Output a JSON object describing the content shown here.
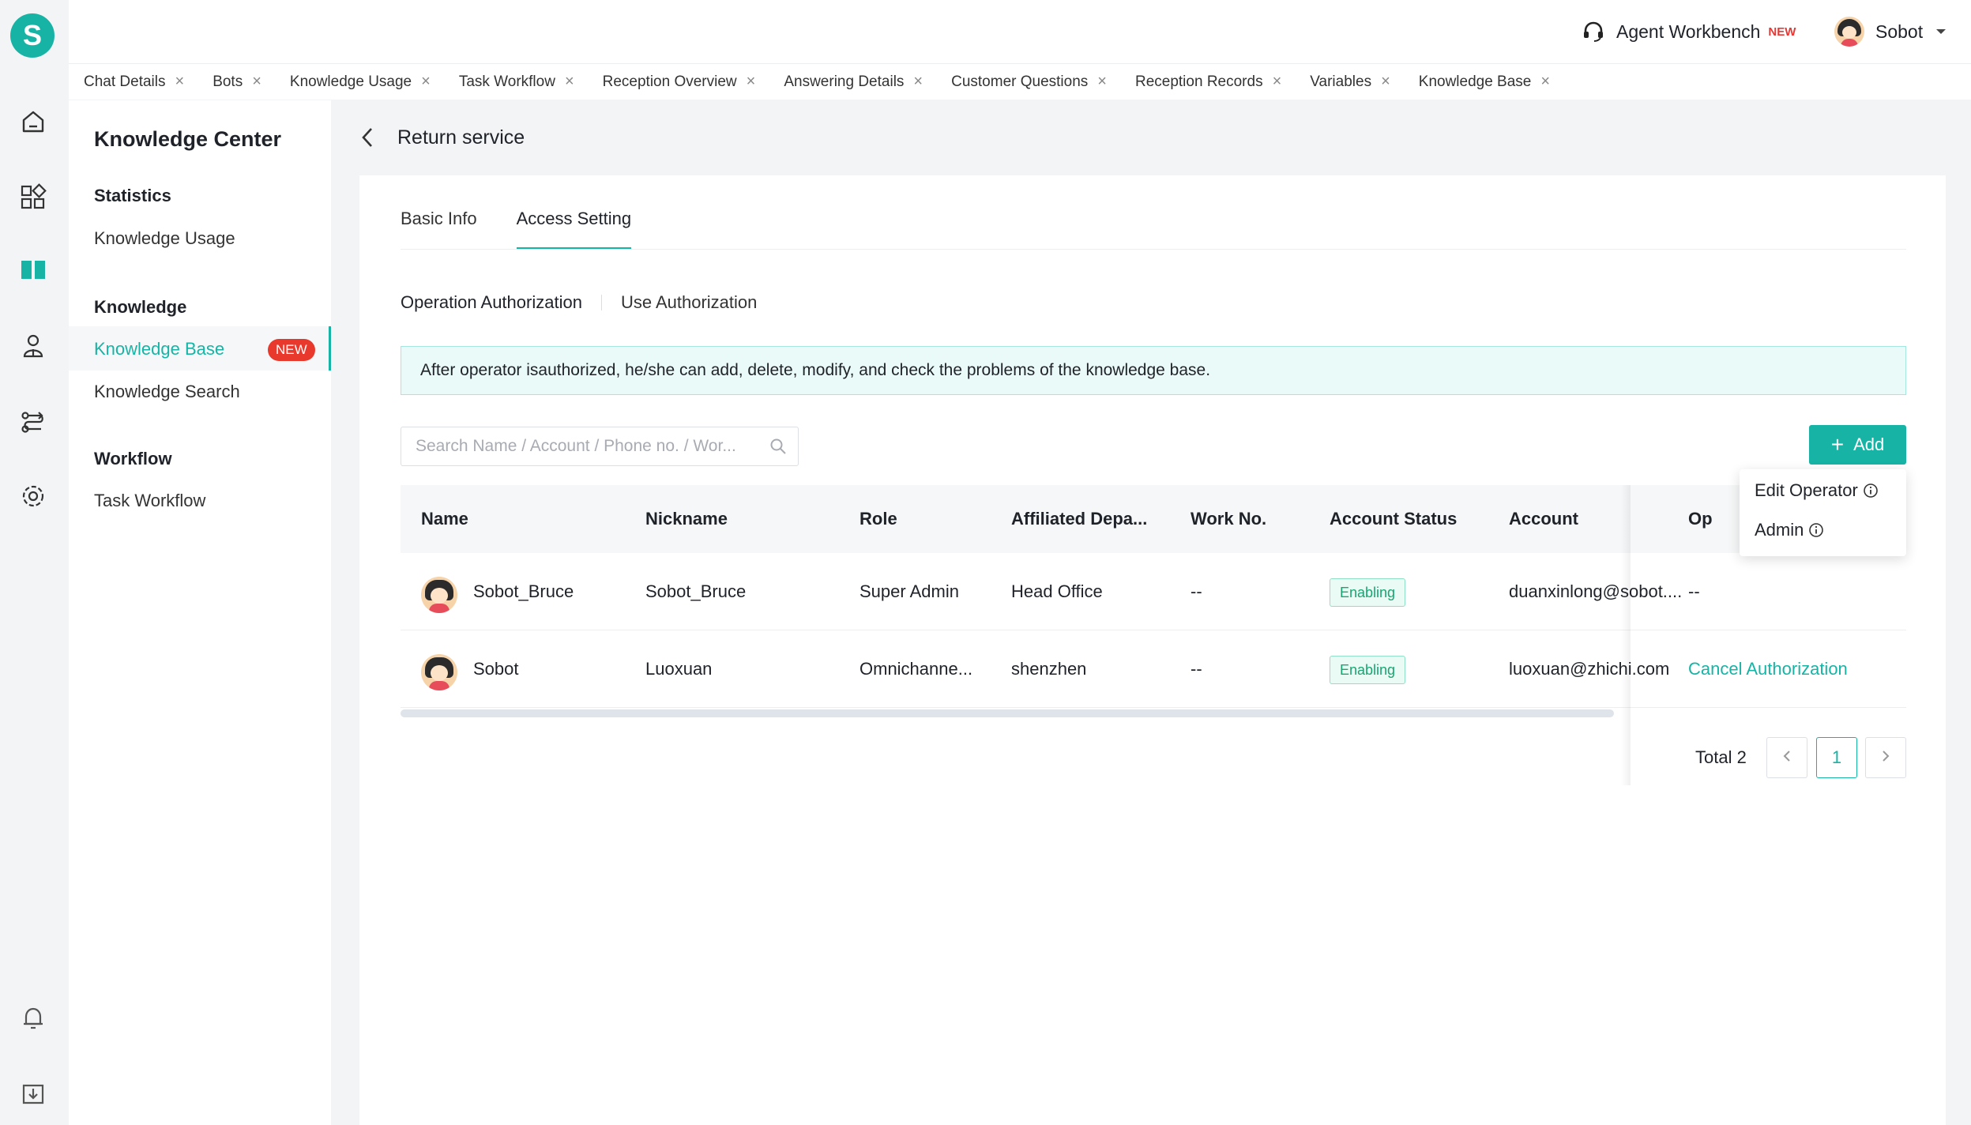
{
  "app": {
    "logo_letter": "S",
    "workbench_label": "Agent Workbench",
    "workbench_badge": "NEW",
    "user_name": "Sobot"
  },
  "rail_icons": [
    "home-icon",
    "apps-icon",
    "book-icon",
    "customer-icon",
    "workflow-icon",
    "settings-icon",
    "bell-icon",
    "download-icon"
  ],
  "tabs": [
    {
      "label": "Chat Details"
    },
    {
      "label": "Bots"
    },
    {
      "label": "Knowledge Usage"
    },
    {
      "label": "Task Workflow"
    },
    {
      "label": "Reception Overview"
    },
    {
      "label": "Answering Details"
    },
    {
      "label": "Customer Questions"
    },
    {
      "label": "Reception Records"
    },
    {
      "label": "Variables"
    },
    {
      "label": "Knowledge Base"
    }
  ],
  "sidebar": {
    "title": "Knowledge Center",
    "groups": [
      {
        "label": "Statistics",
        "items": [
          "Knowledge Usage"
        ]
      },
      {
        "label": "Knowledge",
        "items": [
          "Knowledge Base",
          "Knowledge Search"
        ]
      },
      {
        "label": "Workflow",
        "items": [
          "Task Workflow"
        ]
      }
    ],
    "active_badge": "NEW"
  },
  "page": {
    "title": "Return service",
    "tabs": [
      "Basic Info",
      "Access Setting"
    ],
    "active_tab": "Access Setting",
    "subtabs": [
      "Operation Authorization",
      "Use Authorization"
    ],
    "notice": "After operator isauthorized, he/she can add, delete, modify, and check the problems of the knowledge base.",
    "search_placeholder": "Search Name / Account / Phone no. / Wor...",
    "add_label": "Add"
  },
  "table": {
    "columns": [
      "Name",
      "Nickname",
      "Role",
      "Affiliated Depa...",
      "Work No.",
      "Account Status",
      "Account",
      "Op"
    ],
    "rows": [
      {
        "name": "Sobot_Bruce",
        "nickname": "Sobot_Bruce",
        "role": "Super Admin",
        "dept": "Head Office",
        "work_no": "--",
        "status": "Enabling",
        "account": "duanxinlong@sobot....",
        "op": "--"
      },
      {
        "name": "Sobot",
        "nickname": "Luoxuan",
        "role": "Omnichanne...",
        "dept": "shenzhen",
        "work_no": "--",
        "status": "Enabling",
        "account": "luoxuan@zhichi.com",
        "op": "Cancel Authorization"
      }
    ]
  },
  "popover": {
    "items": [
      "Edit Operator",
      "Admin"
    ]
  },
  "pagination": {
    "total_label": "Total 2",
    "current_page": "1"
  },
  "colors": {
    "accent": "#17b4a6",
    "badge_red": "#e8392c",
    "status_green": "#17a672"
  }
}
